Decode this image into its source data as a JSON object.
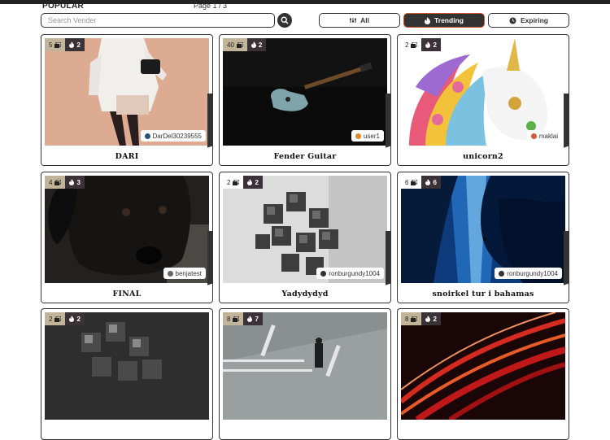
{
  "header": {
    "heading": "POPULAR",
    "page_info": "Page 1 / 3"
  },
  "search": {
    "placeholder": "Search Vender",
    "value": ""
  },
  "filters": [
    {
      "label": "All",
      "icon": "filter-icon",
      "active": false
    },
    {
      "label": "Trending",
      "icon": "fire-icon",
      "active": true
    },
    {
      "label": "Expiring",
      "icon": "clock-icon",
      "active": false
    }
  ],
  "cards": [
    {
      "title": "DARI",
      "count": "5",
      "likes": "2",
      "user": "DarDel30239555",
      "image": "woman-white-coat"
    },
    {
      "title": "Fender Guitar",
      "count": "40",
      "likes": "2",
      "user": "user1",
      "image": "guitar-dark"
    },
    {
      "title": "unicorn2",
      "count": "2",
      "likes": "2",
      "user": "maklai",
      "image": "unicorn"
    },
    {
      "title": "FINAL",
      "count": "4",
      "likes": "3",
      "user": "benjatest",
      "image": "black-puppy"
    },
    {
      "title": "Yadydydyd",
      "count": "2",
      "likes": "2",
      "user": "ronburgundy1004",
      "image": "cubes-sculpture"
    },
    {
      "title": "snoirkel tur i bahamas",
      "count": "6",
      "likes": "6",
      "user": "ronburgundy1004",
      "image": "underwater-cave"
    },
    {
      "title": "",
      "count": "2",
      "likes": "2",
      "user": "",
      "image": "cubes-sculpture"
    },
    {
      "title": "",
      "count": "8",
      "likes": "7",
      "user": "",
      "image": "man-on-road"
    },
    {
      "title": "",
      "count": "8",
      "likes": "2",
      "user": "",
      "image": "light-streaks"
    }
  ]
}
